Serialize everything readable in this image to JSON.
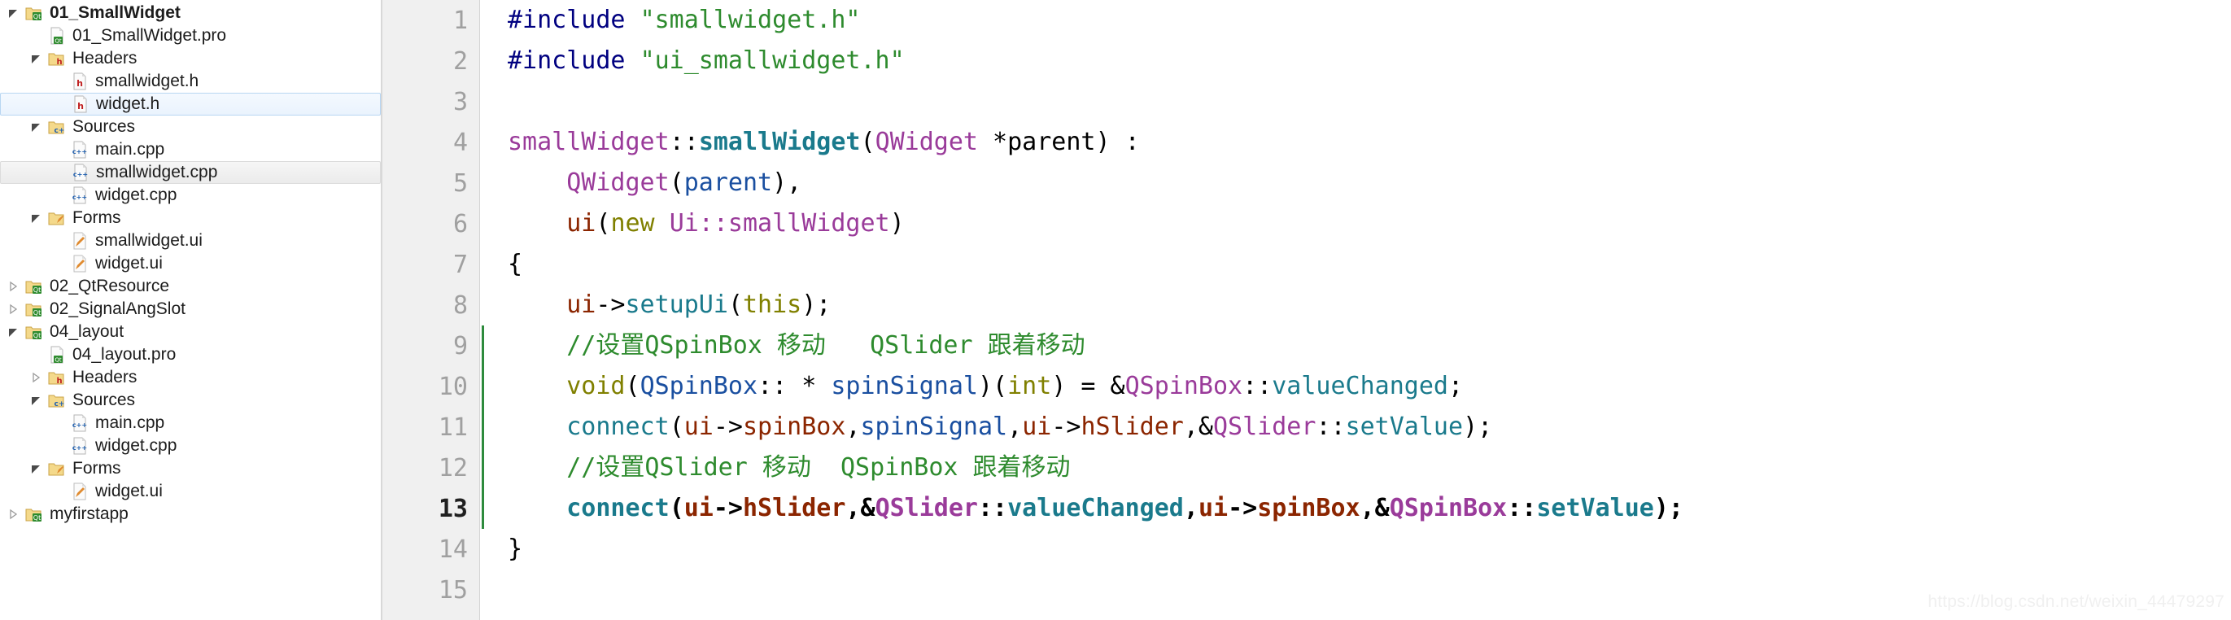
{
  "sidebar": {
    "name": "project-tree",
    "items": [
      {
        "label": "01_SmallWidget",
        "indent": 0,
        "arrow": "expanded",
        "icon": "qt-project-icon",
        "bold": true,
        "selected": "none"
      },
      {
        "label": "01_SmallWidget.pro",
        "indent": 1,
        "arrow": "none",
        "icon": "qt-pro-file-icon",
        "bold": false,
        "selected": "none"
      },
      {
        "label": "Headers",
        "indent": 1,
        "arrow": "expanded",
        "icon": "folder-h-icon",
        "bold": false,
        "selected": "none"
      },
      {
        "label": "smallwidget.h",
        "indent": 2,
        "arrow": "none",
        "icon": "header-file-icon",
        "bold": false,
        "selected": "none"
      },
      {
        "label": "widget.h",
        "indent": 2,
        "arrow": "none",
        "icon": "header-file-icon",
        "bold": false,
        "selected": "focus"
      },
      {
        "label": "Sources",
        "indent": 1,
        "arrow": "expanded",
        "icon": "folder-cpp-icon",
        "bold": false,
        "selected": "none"
      },
      {
        "label": "main.cpp",
        "indent": 2,
        "arrow": "none",
        "icon": "cpp-file-icon",
        "bold": false,
        "selected": "none"
      },
      {
        "label": "smallwidget.cpp",
        "indent": 2,
        "arrow": "none",
        "icon": "cpp-file-icon",
        "bold": false,
        "selected": "blur"
      },
      {
        "label": "widget.cpp",
        "indent": 2,
        "arrow": "none",
        "icon": "cpp-file-icon",
        "bold": false,
        "selected": "none"
      },
      {
        "label": "Forms",
        "indent": 1,
        "arrow": "expanded",
        "icon": "folder-ui-icon",
        "bold": false,
        "selected": "none"
      },
      {
        "label": "smallwidget.ui",
        "indent": 2,
        "arrow": "none",
        "icon": "ui-file-icon",
        "bold": false,
        "selected": "none"
      },
      {
        "label": "widget.ui",
        "indent": 2,
        "arrow": "none",
        "icon": "ui-file-icon",
        "bold": false,
        "selected": "none"
      },
      {
        "label": "02_QtResource",
        "indent": 0,
        "arrow": "collapsed",
        "icon": "qt-project-icon",
        "bold": false,
        "selected": "none"
      },
      {
        "label": "02_SignalAngSlot",
        "indent": 0,
        "arrow": "collapsed",
        "icon": "qt-project-icon",
        "bold": false,
        "selected": "none"
      },
      {
        "label": "04_layout",
        "indent": 0,
        "arrow": "expanded",
        "icon": "qt-project-icon",
        "bold": false,
        "selected": "none"
      },
      {
        "label": "04_layout.pro",
        "indent": 1,
        "arrow": "none",
        "icon": "qt-pro-file-icon",
        "bold": false,
        "selected": "none"
      },
      {
        "label": "Headers",
        "indent": 1,
        "arrow": "collapsed",
        "icon": "folder-h-icon",
        "bold": false,
        "selected": "none"
      },
      {
        "label": "Sources",
        "indent": 1,
        "arrow": "expanded",
        "icon": "folder-cpp-icon",
        "bold": false,
        "selected": "none"
      },
      {
        "label": "main.cpp",
        "indent": 2,
        "arrow": "none",
        "icon": "cpp-file-icon",
        "bold": false,
        "selected": "none"
      },
      {
        "label": "widget.cpp",
        "indent": 2,
        "arrow": "none",
        "icon": "cpp-file-icon",
        "bold": false,
        "selected": "none"
      },
      {
        "label": "Forms",
        "indent": 1,
        "arrow": "expanded",
        "icon": "folder-ui-icon",
        "bold": false,
        "selected": "none"
      },
      {
        "label": "widget.ui",
        "indent": 2,
        "arrow": "none",
        "icon": "ui-file-icon",
        "bold": false,
        "selected": "none"
      },
      {
        "label": "myfirstapp",
        "indent": 0,
        "arrow": "collapsed",
        "icon": "qt-project-icon",
        "bold": false,
        "selected": "none"
      }
    ]
  },
  "editor": {
    "name": "code-editor",
    "language": "cpp",
    "current_line": 13,
    "lines": [
      {
        "n": 1,
        "fold": false,
        "block": false,
        "bold": false,
        "tokens": [
          {
            "t": "#include ",
            "c": "t-pre"
          },
          {
            "t": "\"smallwidget.h\"",
            "c": "t-str"
          }
        ]
      },
      {
        "n": 2,
        "fold": false,
        "block": false,
        "bold": false,
        "tokens": [
          {
            "t": "#include ",
            "c": "t-pre"
          },
          {
            "t": "\"ui_smallwidget.h\"",
            "c": "t-str"
          }
        ]
      },
      {
        "n": 3,
        "fold": false,
        "block": false,
        "bold": false,
        "tokens": []
      },
      {
        "n": 4,
        "fold": false,
        "block": false,
        "bold": false,
        "tokens": [
          {
            "t": "smallWidget",
            "c": "t-cls"
          },
          {
            "t": "::",
            "c": "t-pl"
          },
          {
            "t": "smallWidget",
            "c": "t-fndef"
          },
          {
            "t": "(",
            "c": "t-pl"
          },
          {
            "t": "QWidget",
            "c": "t-cls"
          },
          {
            "t": " *parent) :",
            "c": "t-pl"
          }
        ]
      },
      {
        "n": 5,
        "fold": false,
        "block": false,
        "bold": false,
        "tokens": [
          {
            "t": "    ",
            "c": "t-pl"
          },
          {
            "t": "QWidget",
            "c": "t-cls"
          },
          {
            "t": "(",
            "c": "t-pl"
          },
          {
            "t": "parent",
            "c": "t-id"
          },
          {
            "t": "),",
            "c": "t-pl"
          }
        ]
      },
      {
        "n": 6,
        "fold": true,
        "block": false,
        "bold": false,
        "tokens": [
          {
            "t": "    ",
            "c": "t-pl"
          },
          {
            "t": "ui",
            "c": "t-var"
          },
          {
            "t": "(",
            "c": "t-pl"
          },
          {
            "t": "new",
            "c": "t-kw"
          },
          {
            "t": " ",
            "c": "t-pl"
          },
          {
            "t": "Ui::smallWidget",
            "c": "t-cls"
          },
          {
            "t": ")",
            "c": "t-pl"
          }
        ]
      },
      {
        "n": 7,
        "fold": false,
        "block": false,
        "bold": false,
        "tokens": [
          {
            "t": "{",
            "c": "t-pl"
          }
        ]
      },
      {
        "n": 8,
        "fold": false,
        "block": false,
        "bold": false,
        "tokens": [
          {
            "t": "    ",
            "c": "t-pl"
          },
          {
            "t": "ui",
            "c": "t-var"
          },
          {
            "t": "->",
            "c": "t-pl"
          },
          {
            "t": "setupUi",
            "c": "t-fn"
          },
          {
            "t": "(",
            "c": "t-pl"
          },
          {
            "t": "this",
            "c": "t-kw"
          },
          {
            "t": ");",
            "c": "t-pl"
          }
        ]
      },
      {
        "n": 9,
        "fold": false,
        "block": true,
        "bold": false,
        "tokens": [
          {
            "t": "    //设置QSpinBox 移动   QSlider 跟着移动",
            "c": "t-cmt"
          }
        ]
      },
      {
        "n": 10,
        "fold": false,
        "block": true,
        "bold": false,
        "tokens": [
          {
            "t": "    ",
            "c": "t-pl"
          },
          {
            "t": "void",
            "c": "t-kw"
          },
          {
            "t": "(",
            "c": "t-pl"
          },
          {
            "t": "QSpinBox",
            "c": "t-id"
          },
          {
            "t": ":: * ",
            "c": "t-pl"
          },
          {
            "t": "spinSignal",
            "c": "t-id"
          },
          {
            "t": ")(",
            "c": "t-pl"
          },
          {
            "t": "int",
            "c": "t-kw"
          },
          {
            "t": ") = &",
            "c": "t-pl"
          },
          {
            "t": "QSpinBox",
            "c": "t-cls"
          },
          {
            "t": "::",
            "c": "t-pl"
          },
          {
            "t": "valueChanged",
            "c": "t-fn"
          },
          {
            "t": ";",
            "c": "t-pl"
          }
        ]
      },
      {
        "n": 11,
        "fold": false,
        "block": true,
        "bold": false,
        "tokens": [
          {
            "t": "    ",
            "c": "t-pl"
          },
          {
            "t": "connect",
            "c": "t-fn"
          },
          {
            "t": "(",
            "c": "t-pl"
          },
          {
            "t": "ui",
            "c": "t-var"
          },
          {
            "t": "->",
            "c": "t-pl"
          },
          {
            "t": "spinBox",
            "c": "t-var"
          },
          {
            "t": ",",
            "c": "t-pl"
          },
          {
            "t": "spinSignal",
            "c": "t-id"
          },
          {
            "t": ",",
            "c": "t-pl"
          },
          {
            "t": "ui",
            "c": "t-var"
          },
          {
            "t": "->",
            "c": "t-pl"
          },
          {
            "t": "hSlider",
            "c": "t-var"
          },
          {
            "t": ",&",
            "c": "t-pl"
          },
          {
            "t": "QSlider",
            "c": "t-cls"
          },
          {
            "t": "::",
            "c": "t-pl"
          },
          {
            "t": "setValue",
            "c": "t-fn"
          },
          {
            "t": ");",
            "c": "t-pl"
          }
        ]
      },
      {
        "n": 12,
        "fold": false,
        "block": true,
        "bold": false,
        "tokens": [
          {
            "t": "    //设置QSlider 移动  QSpinBox 跟着移动",
            "c": "t-cmt"
          }
        ]
      },
      {
        "n": 13,
        "fold": false,
        "block": true,
        "bold": true,
        "tokens": [
          {
            "t": "    ",
            "c": "t-pl"
          },
          {
            "t": "connect",
            "c": "t-fn"
          },
          {
            "t": "(",
            "c": "t-pl"
          },
          {
            "t": "ui",
            "c": "t-var"
          },
          {
            "t": "->",
            "c": "t-pl"
          },
          {
            "t": "hSlider",
            "c": "t-var"
          },
          {
            "t": ",&",
            "c": "t-pl"
          },
          {
            "t": "QSlider",
            "c": "t-cls"
          },
          {
            "t": "::",
            "c": "t-pl"
          },
          {
            "t": "valueChanged",
            "c": "t-fn"
          },
          {
            "t": ",",
            "c": "t-pl"
          },
          {
            "t": "ui",
            "c": "t-var"
          },
          {
            "t": "->",
            "c": "t-pl"
          },
          {
            "t": "spinBox",
            "c": "t-var"
          },
          {
            "t": ",&",
            "c": "t-pl"
          },
          {
            "t": "QSpinBox",
            "c": "t-cls"
          },
          {
            "t": "::",
            "c": "t-pl"
          },
          {
            "t": "setValue",
            "c": "t-fn"
          },
          {
            "t": ");",
            "c": "t-pl"
          }
        ]
      },
      {
        "n": 14,
        "fold": false,
        "block": false,
        "bold": false,
        "tokens": [
          {
            "t": "}",
            "c": "t-pl"
          }
        ]
      },
      {
        "n": 15,
        "fold": false,
        "block": false,
        "bold": false,
        "tokens": []
      }
    ]
  },
  "watermark": {
    "text": "https://blog.csdn.net/weixin_44479297"
  },
  "colors": {
    "gutter_bg": "#f0f0f0",
    "gutter_text": "#a0a0a0",
    "selection_focus": "#eaf3fd",
    "selection_blur": "#ebebeb",
    "comment": "#2e8b2e",
    "string": "#2e8b2e",
    "preprocessor": "#000080",
    "class_type": "#9a3b9a",
    "function": "#1a7a8c",
    "keyword": "#808000",
    "member_var": "#8b2500",
    "identifier": "#1a4fa0",
    "block_marker": "#2e8b3d"
  }
}
